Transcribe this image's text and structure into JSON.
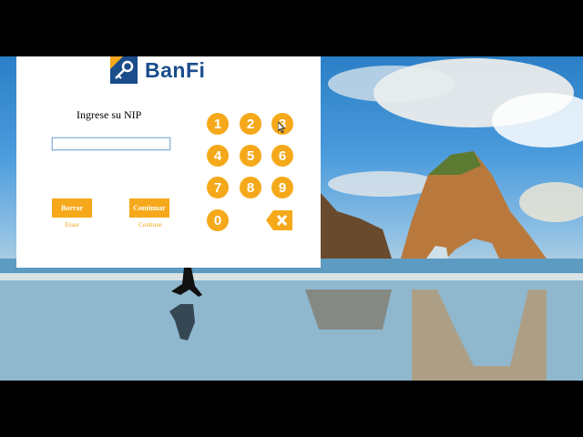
{
  "app": {
    "brand": "BanFi",
    "brand_color": "#1a4d8c",
    "accent_color": "#f5a91a"
  },
  "login": {
    "prompt": "Ingrese su NIP",
    "pin_value": "",
    "keypad": [
      "1",
      "2",
      "3",
      "4",
      "5",
      "6",
      "7",
      "8",
      "9",
      "0"
    ],
    "backspace_icon": "backspace-x-icon",
    "erase_label": "Borrar",
    "erase_sublabel": "Erase",
    "continue_label": "Continuar",
    "continue_sublabel": "Continue"
  },
  "desktop": {
    "wallpaper": "beach-rock-wallpaper"
  }
}
